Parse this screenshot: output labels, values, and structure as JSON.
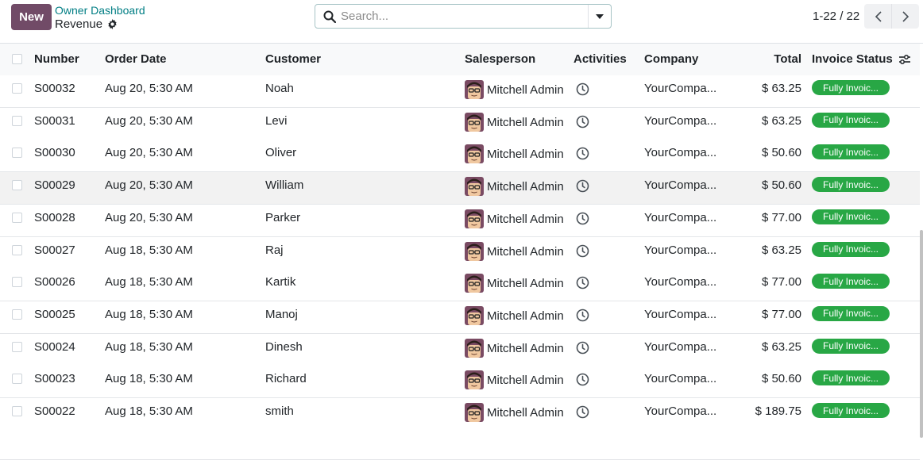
{
  "toolbar": {
    "new_label": "New"
  },
  "breadcrumb": {
    "parent": "Owner Dashboard",
    "current": "Revenue"
  },
  "search": {
    "placeholder": "Search..."
  },
  "pager": {
    "text": "1-22 / 22"
  },
  "table": {
    "columns": [
      "Number",
      "Order Date",
      "Customer",
      "Salesperson",
      "Activities",
      "Company",
      "Total",
      "Invoice Status"
    ],
    "rows": [
      {
        "number": "S00032",
        "date": "Aug 20, 5:30 AM",
        "customer": "Noah",
        "salesperson": "Mitchell Admin",
        "company": "YourCompa...",
        "total": "$ 63.25",
        "status": "Fully Invoic..."
      },
      {
        "number": "S00031",
        "date": "Aug 20, 5:30 AM",
        "customer": "Levi",
        "salesperson": "Mitchell Admin",
        "company": "YourCompa...",
        "total": "$ 63.25",
        "status": "Fully Invoic..."
      },
      {
        "number": "S00030",
        "date": "Aug 20, 5:30 AM",
        "customer": "Oliver",
        "salesperson": "Mitchell Admin",
        "company": "YourCompa...",
        "total": "$ 50.60",
        "status": "Fully Invoic..."
      },
      {
        "number": "S00029",
        "date": "Aug 20, 5:30 AM",
        "customer": "William",
        "salesperson": "Mitchell Admin",
        "company": "YourCompa...",
        "total": "$ 50.60",
        "status": "Fully Invoic..."
      },
      {
        "number": "S00028",
        "date": "Aug 20, 5:30 AM",
        "customer": "Parker",
        "salesperson": "Mitchell Admin",
        "company": "YourCompa...",
        "total": "$ 77.00",
        "status": "Fully Invoic..."
      },
      {
        "number": "S00027",
        "date": "Aug 18, 5:30 AM",
        "customer": "Raj",
        "salesperson": "Mitchell Admin",
        "company": "YourCompa...",
        "total": "$ 63.25",
        "status": "Fully Invoic..."
      },
      {
        "number": "S00026",
        "date": "Aug 18, 5:30 AM",
        "customer": "Kartik",
        "salesperson": "Mitchell Admin",
        "company": "YourCompa...",
        "total": "$ 77.00",
        "status": "Fully Invoic..."
      },
      {
        "number": "S00025",
        "date": "Aug 18, 5:30 AM",
        "customer": "Manoj",
        "salesperson": "Mitchell Admin",
        "company": "YourCompa...",
        "total": "$ 77.00",
        "status": "Fully Invoic..."
      },
      {
        "number": "S00024",
        "date": "Aug 18, 5:30 AM",
        "customer": "Dinesh",
        "salesperson": "Mitchell Admin",
        "company": "YourCompa...",
        "total": "$ 63.25",
        "status": "Fully Invoic..."
      },
      {
        "number": "S00023",
        "date": "Aug 18, 5:30 AM",
        "customer": "Richard",
        "salesperson": "Mitchell Admin",
        "company": "YourCompa...",
        "total": "$ 50.60",
        "status": "Fully Invoic..."
      },
      {
        "number": "S00022",
        "date": "Aug 18, 5:30 AM",
        "customer": "smith",
        "salesperson": "Mitchell Admin",
        "company": "YourCompa...",
        "total": "$ 189.75",
        "status": "Fully Invoic..."
      }
    ]
  },
  "icons": {
    "gear": "gear-icon",
    "search": "search-icon",
    "dropdown": "caret-down-icon",
    "prev": "chevron-left-icon",
    "next": "chevron-right-icon",
    "column_settings": "sliders-icon",
    "activity": "clock-icon",
    "avatar": "user-avatar"
  },
  "colors": {
    "primary": "#714b67",
    "link": "#017e84",
    "status_green": "#28a745"
  }
}
